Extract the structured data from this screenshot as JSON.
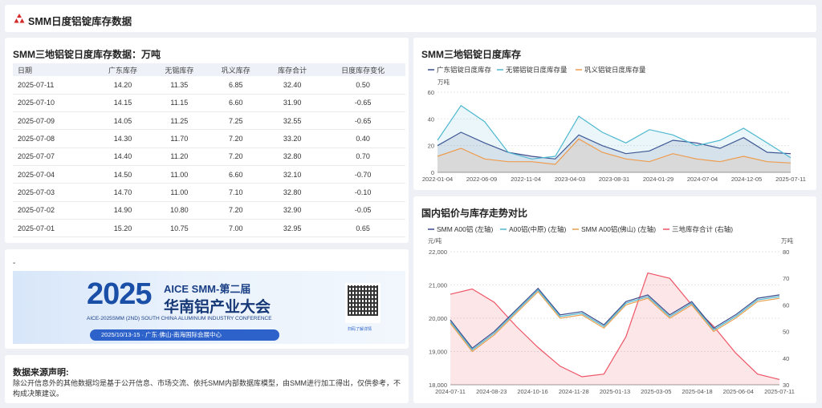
{
  "header": {
    "title": "SMM日度铝锭库存数据"
  },
  "table": {
    "title": "SMM三地铝锭日度库存数据：万吨",
    "columns": [
      "日期",
      "广东库存",
      "无锡库存",
      "巩义库存",
      "库存合计",
      "日度库存变化"
    ],
    "rows": [
      [
        "2025-07-11",
        "14.20",
        "11.35",
        "6.85",
        "32.40",
        "0.50"
      ],
      [
        "2025-07-10",
        "14.15",
        "11.15",
        "6.60",
        "31.90",
        "-0.65"
      ],
      [
        "2025-07-09",
        "14.05",
        "11.25",
        "7.25",
        "32.55",
        "-0.65"
      ],
      [
        "2025-07-08",
        "14.30",
        "11.70",
        "7.20",
        "33.20",
        "0.40"
      ],
      [
        "2025-07-07",
        "14.40",
        "11.20",
        "7.20",
        "32.80",
        "0.70"
      ],
      [
        "2025-07-04",
        "14.50",
        "11.00",
        "6.60",
        "32.10",
        "-0.70"
      ],
      [
        "2025-07-03",
        "14.70",
        "11.00",
        "7.10",
        "32.80",
        "-0.10"
      ],
      [
        "2025-07-02",
        "14.90",
        "10.80",
        "7.20",
        "32.90",
        "-0.05"
      ],
      [
        "2025-07-01",
        "15.20",
        "10.75",
        "7.00",
        "32.95",
        "0.65"
      ]
    ]
  },
  "banner": {
    "dash": "-",
    "big": "2025",
    "line1": "AICE SMM-第二届",
    "line2": "华南铝产业大会",
    "line3": "AICE-2025SMM (2ND) SOUTH CHINA ALUMINUM INDUSTRY CONFERENCE",
    "date": "2025/10/13-15  ·  广东·佛山-南海国际会展中心",
    "qr_caption": "扫码了解详情"
  },
  "source": {
    "title": "数据来源声明:",
    "text": "除公开信息外的其他数据均是基于公开信息、市场交流、依托SMM内部数据库模型，由SMM进行加工得出，仅供参考，不构成决策建议。"
  },
  "colors": {
    "guangdong": "#3b4a8c",
    "wuxi": "#4fb8d0",
    "gongyi": "#ef9b4c",
    "total": "#ee5566",
    "foshan": "#e9a050"
  },
  "chart_data": [
    {
      "type": "line",
      "title": "SMM三地铝锭日度库存",
      "ylabel": "万吨",
      "ylim": [
        0,
        60
      ],
      "yticks": [
        0,
        20,
        40,
        60
      ],
      "x": [
        "2022-01-04",
        "2022-06-09",
        "2022-11-04",
        "2023-04-03",
        "2023-08-31",
        "2024-01-29",
        "2024-07-04",
        "2024-12-05",
        "2025-07-11"
      ],
      "series": [
        {
          "name": "广东铝锭日度库存",
          "values": [
            20,
            30,
            22,
            15,
            12,
            10,
            28,
            20,
            14,
            16,
            24,
            22,
            18,
            26,
            15,
            14
          ]
        },
        {
          "name": "无锡铝锭日度库存量",
          "values": [
            24,
            50,
            38,
            15,
            10,
            12,
            42,
            30,
            22,
            32,
            28,
            20,
            24,
            33,
            22,
            11
          ]
        },
        {
          "name": "巩义铝锭日度库存量",
          "values": [
            12,
            18,
            10,
            8,
            8,
            6,
            25,
            15,
            10,
            8,
            14,
            10,
            8,
            12,
            8,
            7
          ]
        }
      ]
    },
    {
      "type": "line",
      "title": "国内铝价与库存走势对比",
      "ylabel": "元/吨",
      "y2label": "万吨",
      "ylim": [
        18000,
        22000
      ],
      "y2lim": [
        30,
        80
      ],
      "yticks": [
        18000,
        19000,
        20000,
        21000,
        22000
      ],
      "y2ticks": [
        30,
        40,
        50,
        60,
        70,
        80
      ],
      "x": [
        "2024-07-11",
        "2024-08-23",
        "2024-10-16",
        "2024-11-28",
        "2025-01-13",
        "2025-03-05",
        "2025-04-18",
        "2025-06-04",
        "2025-07-11"
      ],
      "series": [
        {
          "name": "SMM A00铝 (左轴)",
          "axis": "left",
          "values": [
            19950,
            19100,
            19600,
            20250,
            20900,
            20100,
            20200,
            19800,
            20500,
            20700,
            20100,
            20500,
            19700,
            20100,
            20600,
            20700
          ]
        },
        {
          "name": "A00铝(中原) (左轴)",
          "axis": "left",
          "values": [
            19900,
            19050,
            19550,
            20200,
            20850,
            20050,
            20150,
            19750,
            20450,
            20650,
            20050,
            20450,
            19650,
            20050,
            20550,
            20650
          ]
        },
        {
          "name": "SMM A00铝(佛山) (左轴)",
          "axis": "left",
          "values": [
            19850,
            19000,
            19500,
            20150,
            20800,
            20000,
            20100,
            19700,
            20400,
            20600,
            20000,
            20400,
            19600,
            20000,
            20500,
            20600
          ]
        },
        {
          "name": "三地库存合计 (右轴)",
          "axis": "right",
          "values": [
            64,
            66,
            61,
            52,
            44,
            37,
            33,
            34,
            48,
            72,
            70,
            60,
            52,
            42,
            34,
            32
          ]
        }
      ]
    }
  ]
}
